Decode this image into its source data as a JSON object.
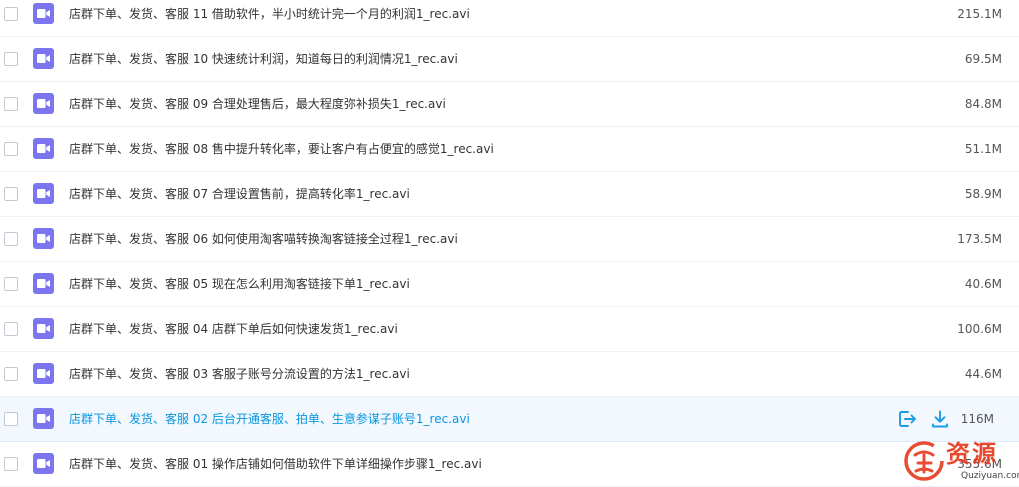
{
  "files": [
    {
      "name": "店群下单、发货、客服 11 借助软件，半小时统计完一个月的利润1_rec.avi",
      "size": "215.1M"
    },
    {
      "name": "店群下单、发货、客服 10 快速统计利润，知道每日的利润情况1_rec.avi",
      "size": "69.5M"
    },
    {
      "name": "店群下单、发货、客服 09 合理处理售后，最大程度弥补损失1_rec.avi",
      "size": "84.8M"
    },
    {
      "name": "店群下单、发货、客服 08 售中提升转化率，要让客户有占便宜的感觉1_rec.avi",
      "size": "51.1M"
    },
    {
      "name": "店群下单、发货、客服 07 合理设置售前，提高转化率1_rec.avi",
      "size": "58.9M"
    },
    {
      "name": "店群下单、发货、客服 06 如何使用淘客喵转换淘客链接全过程1_rec.avi",
      "size": "173.5M"
    },
    {
      "name": "店群下单、发货、客服 05 现在怎么利用淘客链接下单1_rec.avi",
      "size": "40.6M"
    },
    {
      "name": "店群下单、发货、客服 04 店群下单后如何快速发货1_rec.avi",
      "size": "100.6M"
    },
    {
      "name": "店群下单、发货、客服 03 客服子账号分流设置的方法1_rec.avi",
      "size": "44.6M"
    },
    {
      "name": "店群下单、发货、客服 02 后台开通客服、拍单、生意参谋子账号1_rec.avi",
      "size": "116M"
    },
    {
      "name": "店群下单、发货、客服 01 操作店铺如何借助软件下单详细操作步骤1_rec.avi",
      "size": "355.6M"
    }
  ],
  "highlighted_row_index": 9,
  "row_action_icons": [
    "share-icon",
    "download-icon"
  ],
  "file_icon": "video-file-icon",
  "colors": {
    "file_icon_bg": "#7b76f0",
    "highlight_text": "#0996e0",
    "highlight_bg": "#f2f8fe",
    "watermark": "#e53a1e"
  },
  "watermark": {
    "title": "资源",
    "url": "Quziyuan.com"
  }
}
